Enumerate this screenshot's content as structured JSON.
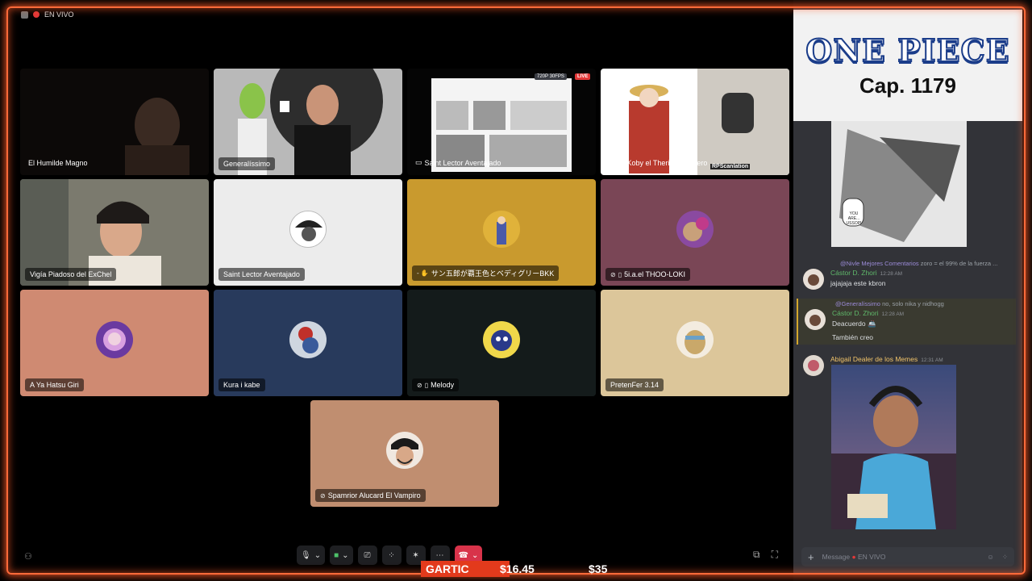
{
  "topbar": {
    "live_label": "EN VIVO"
  },
  "tiles": {
    "humilde": "El Humilde Magno",
    "generalissimo": "Generalíssimo",
    "saint_screen": "Saint Lector Aventajado",
    "saint_screen_badge": "720P 30FPS",
    "saint_screen_live": "LIVE",
    "uziel": "Uziel Koby el Therian Migajero",
    "uziel_watermark": "RPScanlation",
    "vigia": "Vigía Piadoso del ExChel",
    "saint": "Saint Lector Aventajado",
    "san": "サン五郎が覇王色とベディグリーBKK",
    "thoo": "5i.a.el THOO-LOKI",
    "ahatsu": "A Ya Hatsu Giri",
    "kura": "Kura i kabe",
    "melody": "Melody",
    "pretenfer": "PretenFer 3.14",
    "spamrior": "Spamrior Alucard El Vampiro"
  },
  "colors": {
    "accent_glow": "#ff6a3a",
    "live": "#e23838",
    "hangup": "#d8334a",
    "gartic": "#e33a1c",
    "saint_bg": "#ececec",
    "san_bg": "#c99a2e",
    "thoo_bg": "#7a4656",
    "ahatsu_bg": "#cf8a72",
    "kura_bg": "#283a5c",
    "melody_bg": "#141b1b",
    "pretenfer_bg": "#dcc69a",
    "spamrior_bg": "#c08e70"
  },
  "ticker": {
    "gartic": "GARTIC",
    "price": "$16.45",
    "price2": "$35"
  },
  "banner": {
    "logo": "ONE PIECE",
    "chapter": "Cap. 1179"
  },
  "chat": {
    "m1_reply_mention": "@Nivle Mejores Comentarios",
    "m1_reply_text": "zoro = el 99% de la fuerza ...",
    "m1_author": "Cástor D. Zhori",
    "m1_time": "12:28 AM",
    "m1_text": "jajajaja este kbron",
    "m2_reply_mention": "@Generalíssimo",
    "m2_reply_text": "no, solo nika y nidhogg",
    "m2_author": "Cástor D. Zhori",
    "m2_time": "12:28 AM",
    "m2_text": "Deacuerdo",
    "m2_text2": "También creo",
    "m3_author": "Abigail Dealer de los Memes",
    "m3_time": "12:31 AM",
    "manga_bubble": "YOU ARE... USSOP!"
  },
  "msgbox": {
    "placeholder": "Message",
    "channel": "EN VIVO"
  }
}
